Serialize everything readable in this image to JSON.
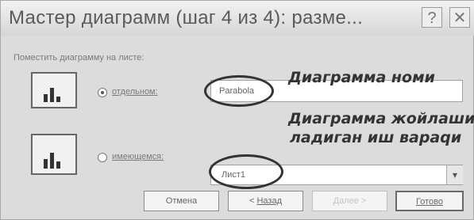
{
  "window": {
    "title": "Мастер диаграмм (шаг 4 из 4): разме...",
    "help_label": "?",
    "close_label": "✕"
  },
  "group_label": "Поместить диаграмму на листе:",
  "options": [
    {
      "label": "отдельном:",
      "selected": true,
      "value": "Parabola"
    },
    {
      "label": "имеющемся:",
      "selected": false,
      "value": "Лист1"
    }
  ],
  "annotations": {
    "name": "Диаграмма номи",
    "place_line1": "Диаграмма жойлаши",
    "place_line2": "ладиган иш вараqи"
  },
  "buttons": {
    "cancel": "Отмена",
    "back_arrow": "< ",
    "back": "Назад",
    "next": "Далее >",
    "finish": "Готово"
  },
  "dropdown_arrow": "▾"
}
